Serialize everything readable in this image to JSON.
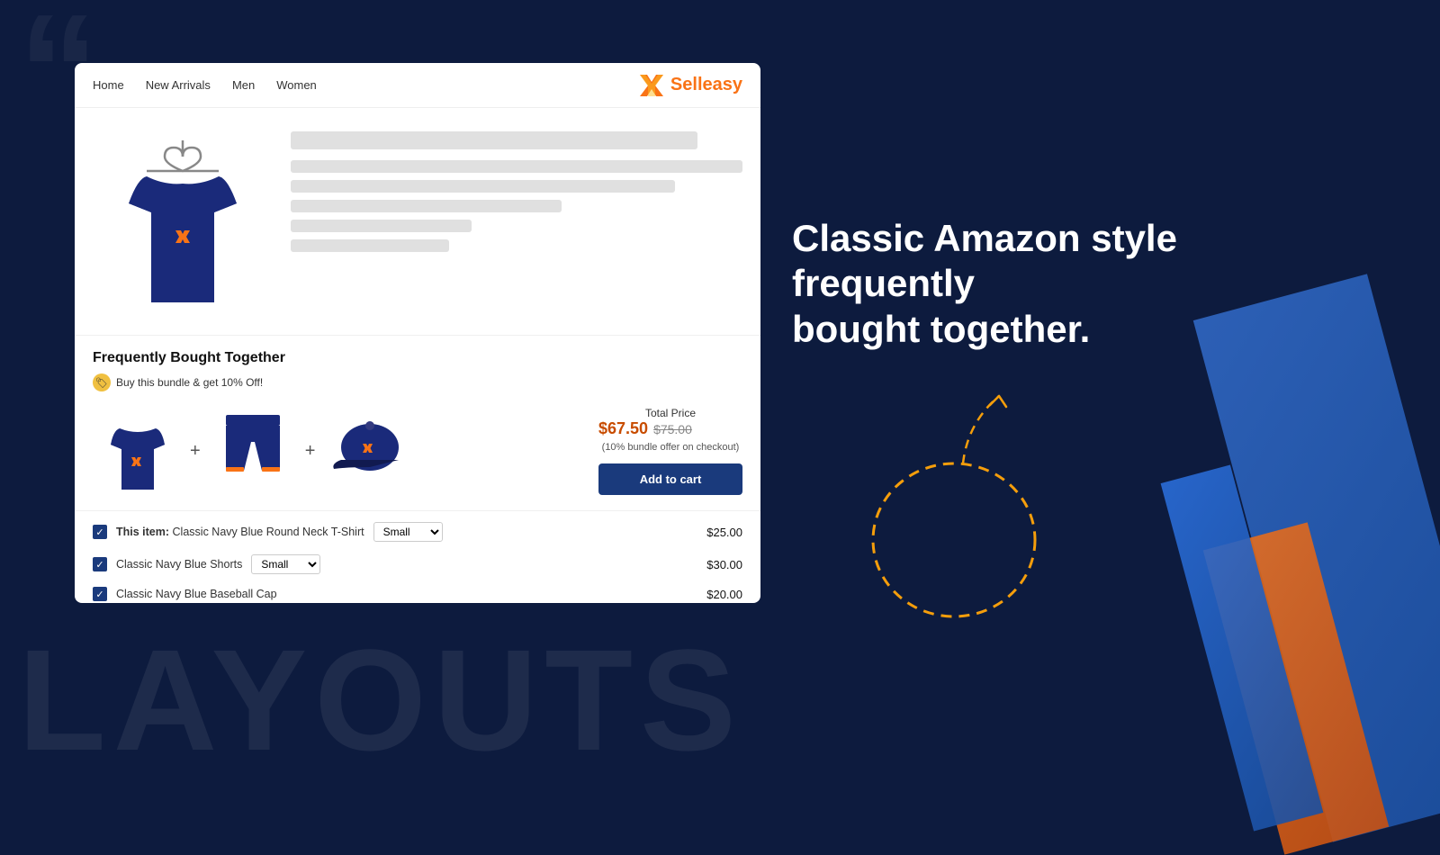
{
  "background": {
    "quote_symbol": "“",
    "layouts_text": "LAYOUTS"
  },
  "nav": {
    "links": [
      "Home",
      "New Arrivals",
      "Men",
      "Women"
    ],
    "logo_sell": "Sell",
    "logo_easy": "easy"
  },
  "product": {
    "skeletons": [
      "title",
      "wide",
      "medium",
      "small",
      "xsmall",
      "tiny"
    ]
  },
  "fbt": {
    "section_title": "Frequently Bought Together",
    "badge_label": "Buy this bundle & get 10% Off!",
    "total_label": "Total Price",
    "new_price": "$67.50",
    "old_price": "$75.00",
    "discount_note": "(10% bundle offer on checkout)",
    "add_to_cart_label": "Add to cart",
    "plus_symbol": "+",
    "items": [
      {
        "checked": true,
        "label_prefix": "This item:",
        "name": "Classic Navy Blue Round Neck T-Shirt",
        "size": "Small",
        "price": "$25.00"
      },
      {
        "checked": true,
        "label_prefix": "",
        "name": "Classic Navy Blue Shorts",
        "size": "Small",
        "price": "$30.00"
      },
      {
        "checked": true,
        "label_prefix": "",
        "name": "Classic Navy Blue Baseball Cap",
        "size": "",
        "price": "$20.00"
      }
    ]
  },
  "headline": {
    "line1": "Classic Amazon style frequently",
    "line2": "bought together."
  }
}
